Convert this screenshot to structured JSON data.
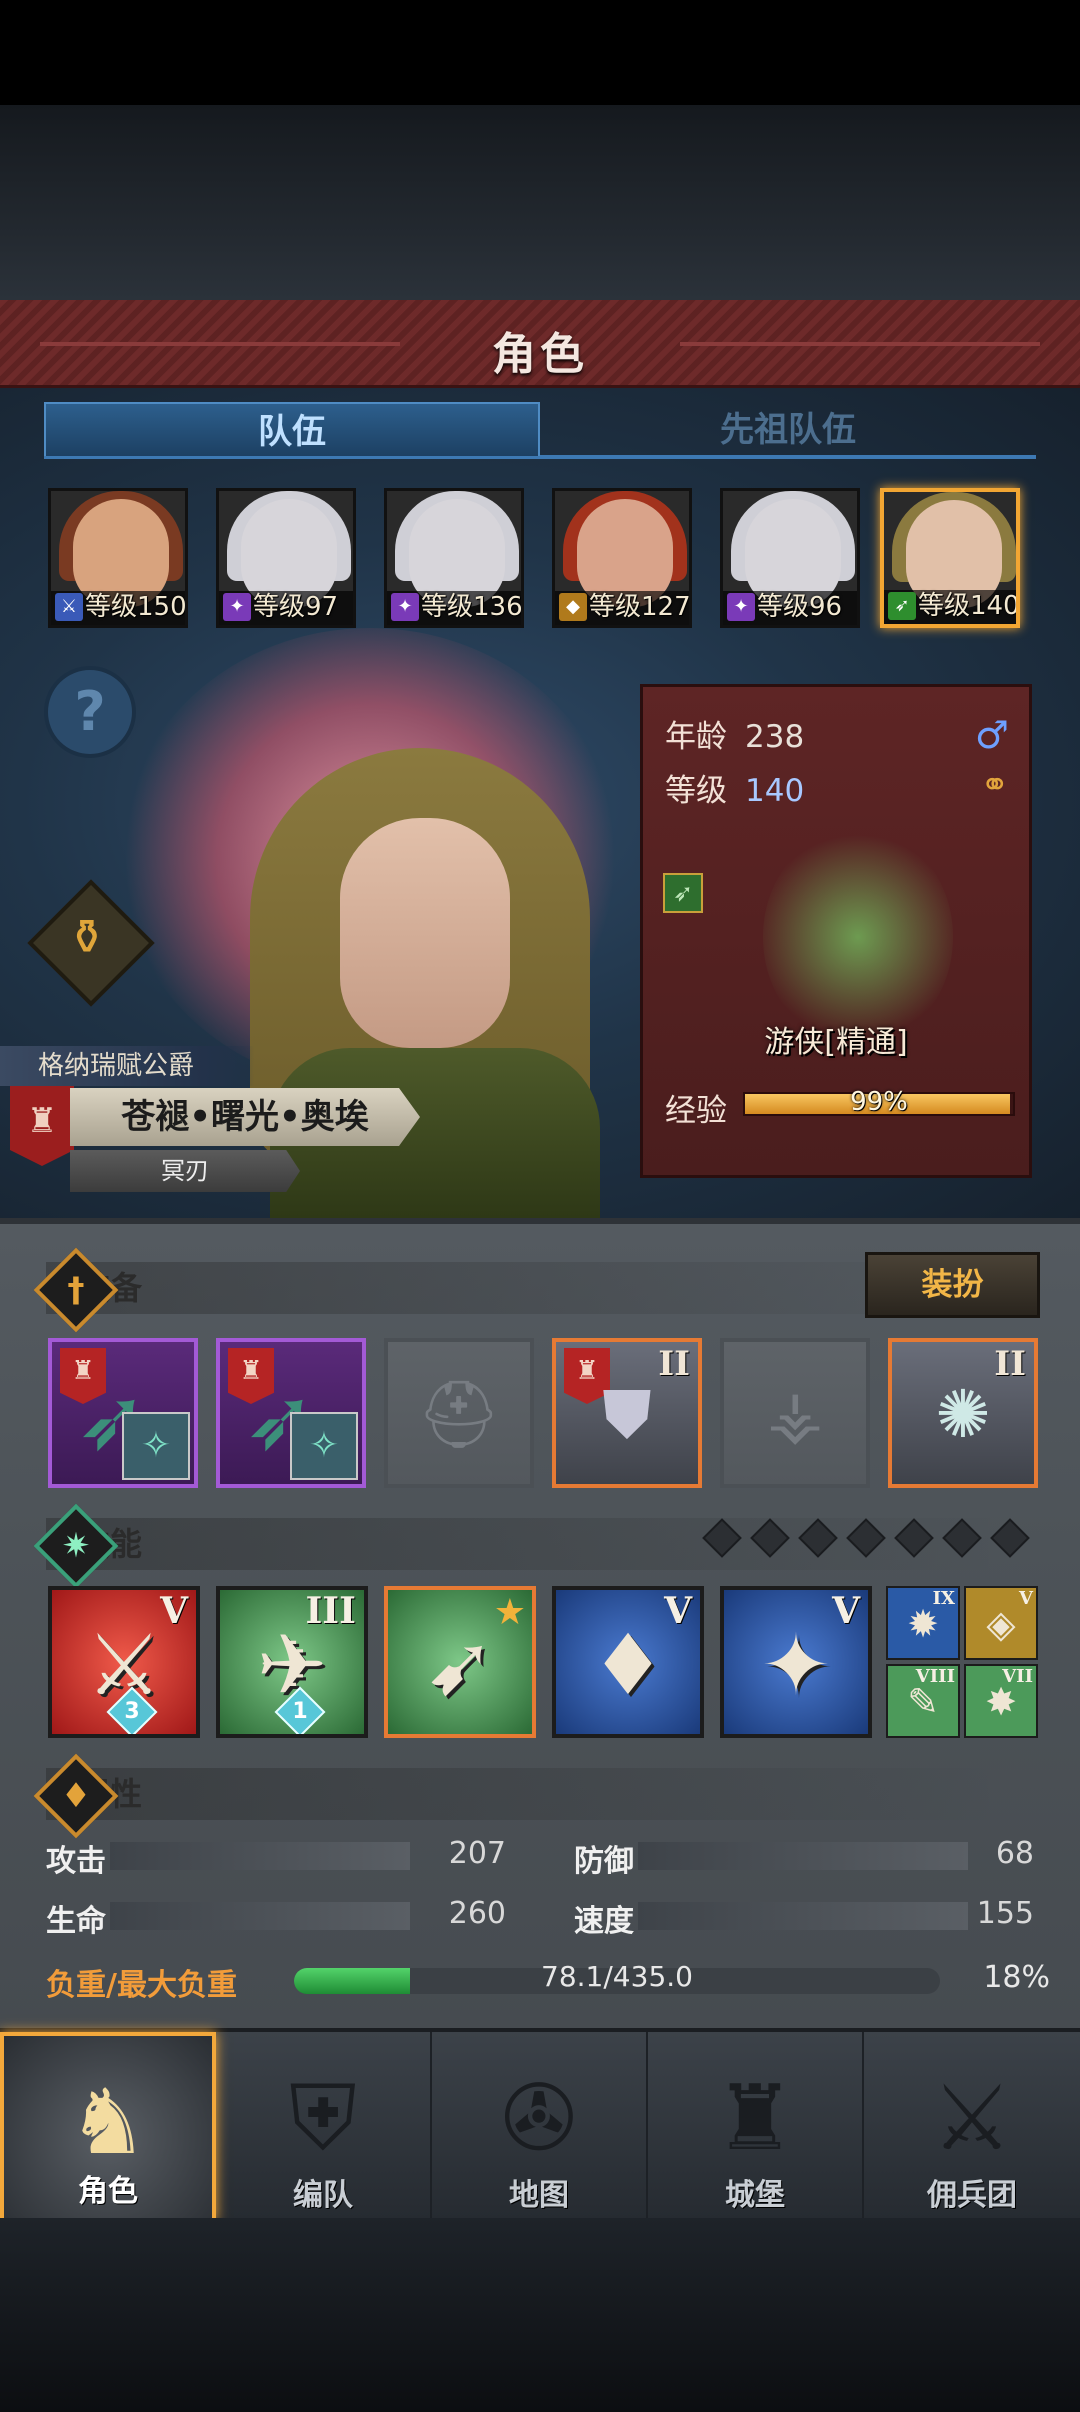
{
  "header": {
    "title": "角色"
  },
  "tabs": [
    {
      "label": "队伍"
    },
    {
      "label": "先祖队伍"
    }
  ],
  "roster": [
    {
      "level": "等级150",
      "face": "#d8a37e",
      "hair": "#7a3a22",
      "cls": "#3a5ab8",
      "glyph": "⚔"
    },
    {
      "level": "等级97",
      "face": "#d7d5da",
      "hair": "#cfcfd6",
      "cls": "#7a3ab8",
      "glyph": "✦"
    },
    {
      "level": "等级136",
      "face": "#d7d5da",
      "hair": "#cfcfd6",
      "cls": "#7a3ab8",
      "glyph": "✦"
    },
    {
      "level": "等级127",
      "face": "#d9a38a",
      "hair": "#a2321c",
      "cls": "#b07a1c",
      "glyph": "◆"
    },
    {
      "level": "等级96",
      "face": "#d7d5da",
      "hair": "#cfcfd6",
      "cls": "#7a3ab8",
      "glyph": "✦"
    },
    {
      "level": "等级140",
      "face": "#e1c0a8",
      "hair": "#8b7a3f",
      "cls": "#2e8e2e",
      "glyph": "➶"
    }
  ],
  "hero": {
    "title": "格纳瑞赋公爵",
    "name": "苍褪•曙光•奥埃",
    "subtitle": "冥刃"
  },
  "info": {
    "age_label": "年龄",
    "age": "238",
    "level_label": "等级",
    "level": "140",
    "class_name": "游侠[精通]",
    "exp_label": "经验",
    "exp_text": "99%",
    "exp_fraction": 0.99
  },
  "equipment": {
    "title": "装备",
    "dress_label": "装扮",
    "slots": [
      {
        "kind": "purple",
        "roman": ""
      },
      {
        "kind": "purple",
        "roman": ""
      },
      {
        "kind": "empty",
        "roman": ""
      },
      {
        "kind": "orange",
        "roman": "II"
      },
      {
        "kind": "empty",
        "roman": ""
      },
      {
        "kind": "orange",
        "roman": "II"
      }
    ]
  },
  "skills": {
    "title": "技能",
    "pip_count": 7,
    "items": [
      {
        "color": "red",
        "roman": "V",
        "gem": "3"
      },
      {
        "color": "green",
        "roman": "III",
        "gem": "1"
      },
      {
        "color": "green",
        "roman": "",
        "gem": ""
      },
      {
        "color": "blue",
        "roman": "V",
        "gem": ""
      },
      {
        "color": "blue",
        "roman": "V",
        "gem": ""
      }
    ],
    "minis": [
      {
        "color": "blue",
        "roman": "IX"
      },
      {
        "color": "gold",
        "roman": "V"
      },
      {
        "color": "green",
        "roman": "VIII"
      },
      {
        "color": "green",
        "roman": "VII"
      }
    ]
  },
  "attributes": {
    "title": "属性",
    "attack_label": "攻击",
    "attack": "207",
    "defense_label": "防御",
    "defense": "68",
    "hp_label": "生命",
    "hp": "260",
    "speed_label": "速度",
    "speed": "155",
    "weight_label": "负重/最大负重",
    "weight_text": "78.1/435.0",
    "weight_pct": "18%",
    "weight_fraction": 0.18
  },
  "nav": [
    {
      "label": "角色"
    },
    {
      "label": "编队"
    },
    {
      "label": "地图"
    },
    {
      "label": "城堡"
    },
    {
      "label": "佣兵团"
    }
  ]
}
